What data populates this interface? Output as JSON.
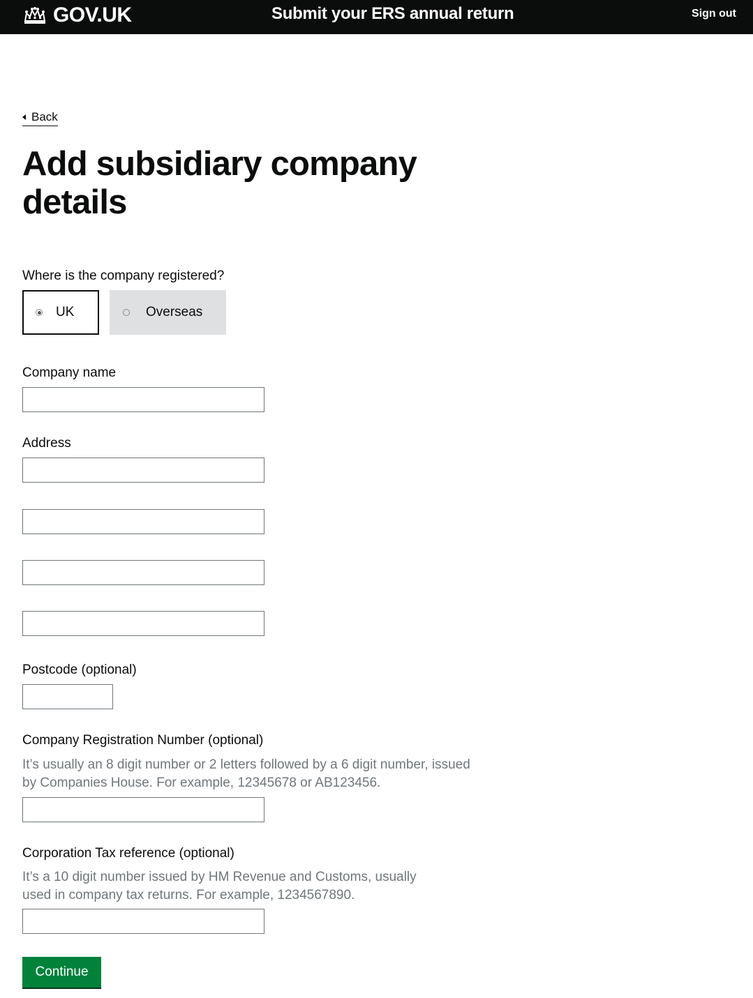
{
  "header": {
    "logo_text": "GOV.UK",
    "service_name": "Submit your ERS annual return",
    "sign_out_label": "Sign out"
  },
  "back_link": "Back",
  "page_title": "Add subsidiary company details",
  "registration": {
    "question": "Where is the company registered?",
    "options": [
      {
        "label": "UK",
        "selected": true
      },
      {
        "label": "Overseas",
        "selected": false
      }
    ]
  },
  "fields": {
    "company_name": {
      "label": "Company name",
      "value": ""
    },
    "address": {
      "label": "Address",
      "lines": [
        "",
        "",
        "",
        ""
      ]
    },
    "postcode": {
      "label": "Postcode (optional)",
      "value": ""
    },
    "crn": {
      "label": "Company Registration Number (optional)",
      "hint_line1": "It’s usually an 8 digit number or 2 letters followed by a 6 digit number, issued",
      "hint_line2": "by Companies House. For example, 12345678 or AB123456.",
      "value": ""
    },
    "ct_ref": {
      "label": "Corporation Tax reference (optional)",
      "hint_line1": "It’s a 10 digit number issued by HM Revenue and Customs, usually",
      "hint_line2": "used in company tax returns. For example, 1234567890.",
      "value": ""
    }
  },
  "continue_label": "Continue",
  "colors": {
    "header_bg": "#0b0c0c",
    "button_green": "#00823b",
    "hint_grey": "#6f777b",
    "selected_option_bg": "#dee0e2"
  }
}
